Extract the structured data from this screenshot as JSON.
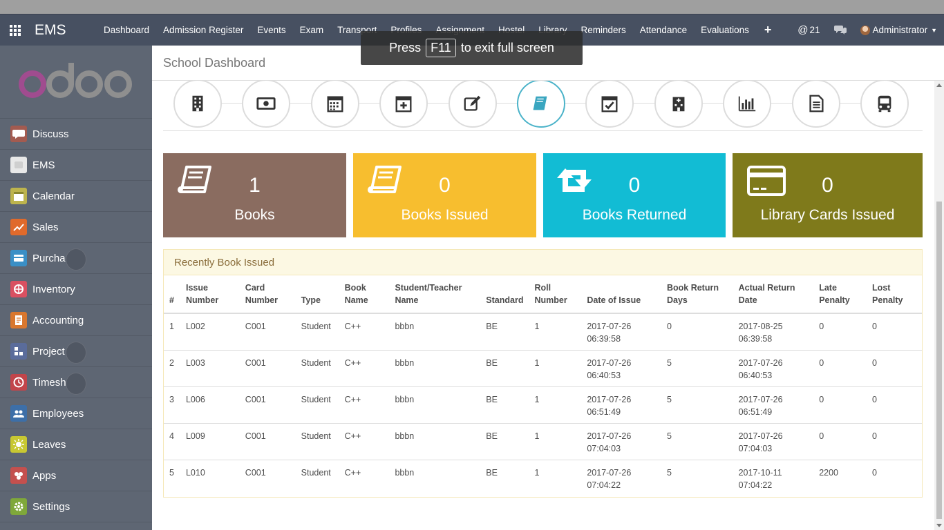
{
  "app": {
    "name": "EMS"
  },
  "topnav": {
    "items": [
      "Dashboard",
      "Admission Register",
      "Events",
      "Exam",
      "Transport",
      "Profiles",
      "Assignment",
      "Hostel",
      "Library",
      "Reminders",
      "Attendance",
      "Evaluations"
    ],
    "plus": "+",
    "mentions": "21",
    "user": "Administrator"
  },
  "fullscreen_toast": {
    "pre": "Press",
    "key": "F11",
    "post": "to exit full screen"
  },
  "sidebar": {
    "logo": "odoo",
    "items": [
      {
        "label": "Discuss",
        "icon": "discuss-icon",
        "color": "#a35b50"
      },
      {
        "label": "EMS",
        "icon": "ems-icon",
        "color": "#e8e8e8"
      },
      {
        "label": "Calendar",
        "icon": "calendar-icon",
        "color": "#bdb44d"
      },
      {
        "label": "Sales",
        "icon": "sales-icon",
        "color": "#e06a2b"
      },
      {
        "label": "Purchases",
        "icon": "purchases-icon",
        "color": "#3a8fc6"
      },
      {
        "label": "Inventory",
        "icon": "inventory-icon",
        "color": "#d95061"
      },
      {
        "label": "Accounting",
        "icon": "accounting-icon",
        "color": "#d9772e"
      },
      {
        "label": "Project",
        "icon": "project-icon",
        "color": "#5a6c9b"
      },
      {
        "label": "Timesheets",
        "icon": "timesheets-icon",
        "color": "#c2454a"
      },
      {
        "label": "Employees",
        "icon": "employees-icon",
        "color": "#3d6fa8"
      },
      {
        "label": "Leaves",
        "icon": "leaves-icon",
        "color": "#c8c832"
      },
      {
        "label": "Apps",
        "icon": "apps-icon",
        "color": "#c4504e"
      },
      {
        "label": "Settings",
        "icon": "settings-icon",
        "color": "#7fa83a"
      }
    ]
  },
  "page": {
    "title": "School Dashboard"
  },
  "dashboard_icons": [
    "building-icon",
    "money-icon",
    "calendar-grid-icon",
    "calendar-plus-icon",
    "edit-icon",
    "book-icon",
    "calendar-check-icon",
    "hospital-icon",
    "bar-chart-icon",
    "document-icon",
    "bus-icon"
  ],
  "active_icon_index": 5,
  "tiles": [
    {
      "count": "1",
      "label": "Books",
      "color": "#8a6c60",
      "icon": "book-icon"
    },
    {
      "count": "0",
      "label": "Books Issued",
      "color": "#f7be2f",
      "icon": "book-icon"
    },
    {
      "count": "0",
      "label": "Books Returned",
      "color": "#12bcd4",
      "icon": "retweet-icon"
    },
    {
      "count": "0",
      "label": "Library Cards Issued",
      "color": "#7f7a1b",
      "icon": "credit-card-icon"
    }
  ],
  "recent": {
    "title": "Recently Book Issued",
    "columns": [
      [
        "#"
      ],
      [
        "Issue",
        "Number"
      ],
      [
        "Card",
        "Number"
      ],
      [
        "Type"
      ],
      [
        "Book",
        "Name"
      ],
      [
        "Student/Teacher",
        "Name"
      ],
      [
        "Standard"
      ],
      [
        "Roll",
        "Number"
      ],
      [
        "Date of Issue"
      ],
      [
        "Book Return",
        "Days"
      ],
      [
        "Actual Return",
        "Date"
      ],
      [
        "Late",
        "Penalty"
      ],
      [
        "Lost",
        "Penalty"
      ]
    ],
    "rows": [
      {
        "idx": "1",
        "issue": "L002",
        "card": "C001",
        "type": "Student",
        "book": "C++",
        "name": "bbbn",
        "standard": "BE",
        "roll": "1",
        "date_issue": [
          "2017-07-26",
          "06:39:58"
        ],
        "return_days": "0",
        "actual_return": [
          "2017-08-25",
          "06:39:58"
        ],
        "late": "0",
        "lost": "0"
      },
      {
        "idx": "2",
        "issue": "L003",
        "card": "C001",
        "type": "Student",
        "book": "C++",
        "name": "bbbn",
        "standard": "BE",
        "roll": "1",
        "date_issue": [
          "2017-07-26",
          "06:40:53"
        ],
        "return_days": "5",
        "actual_return": [
          "2017-07-26",
          "06:40:53"
        ],
        "late": "0",
        "lost": "0"
      },
      {
        "idx": "3",
        "issue": "L006",
        "card": "C001",
        "type": "Student",
        "book": "C++",
        "name": "bbbn",
        "standard": "BE",
        "roll": "1",
        "date_issue": [
          "2017-07-26",
          "06:51:49"
        ],
        "return_days": "5",
        "actual_return": [
          "2017-07-26",
          "06:51:49"
        ],
        "late": "0",
        "lost": "0"
      },
      {
        "idx": "4",
        "issue": "L009",
        "card": "C001",
        "type": "Student",
        "book": "C++",
        "name": "bbbn",
        "standard": "BE",
        "roll": "1",
        "date_issue": [
          "2017-07-26",
          "07:04:03"
        ],
        "return_days": "5",
        "actual_return": [
          "2017-07-26",
          "07:04:03"
        ],
        "late": "0",
        "lost": "0"
      },
      {
        "idx": "5",
        "issue": "L010",
        "card": "C001",
        "type": "Student",
        "book": "C++",
        "name": "bbbn",
        "standard": "BE",
        "roll": "1",
        "date_issue": [
          "2017-07-26",
          "07:04:22"
        ],
        "return_days": "5",
        "actual_return": [
          "2017-10-11",
          "07:04:22"
        ],
        "late": "2200",
        "lost": "0"
      }
    ]
  },
  "colors": {
    "navbar": "#475061",
    "sidebar": "#5e6673",
    "active_ring": "#4bb3c9",
    "panel_head": "#fcf8e3"
  }
}
